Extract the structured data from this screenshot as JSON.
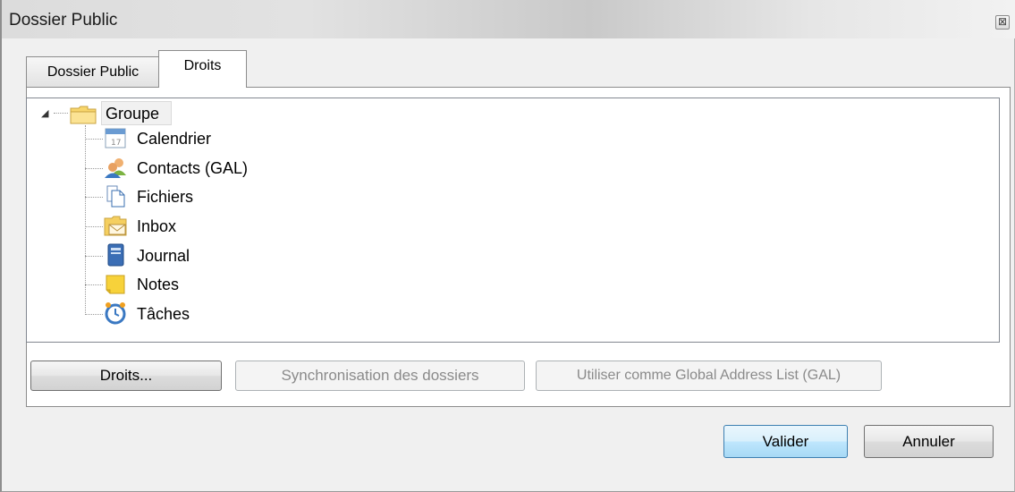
{
  "window": {
    "title": "Dossier Public",
    "close_glyph": "⊠"
  },
  "tabs": [
    {
      "label": "Dossier Public",
      "active": false
    },
    {
      "label": "Droits",
      "active": true
    }
  ],
  "tree": {
    "root": {
      "label": "Groupe",
      "icon": "folder-icon",
      "expanded": true
    },
    "children": [
      {
        "label": "Calendrier",
        "icon": "calendar-icon"
      },
      {
        "label": "Contacts (GAL)",
        "icon": "contacts-icon"
      },
      {
        "label": "Fichiers",
        "icon": "files-icon"
      },
      {
        "label": "Inbox",
        "icon": "inbox-icon"
      },
      {
        "label": "Journal",
        "icon": "journal-icon"
      },
      {
        "label": "Notes",
        "icon": "notes-icon"
      },
      {
        "label": "Tâches",
        "icon": "tasks-icon"
      }
    ]
  },
  "panel_buttons": {
    "rights": "Droits...",
    "sync": "Synchronisation des dossiers",
    "use_gal": "Utiliser comme Global Address List (GAL)"
  },
  "dialog_buttons": {
    "ok": "Valider",
    "cancel": "Annuler"
  }
}
